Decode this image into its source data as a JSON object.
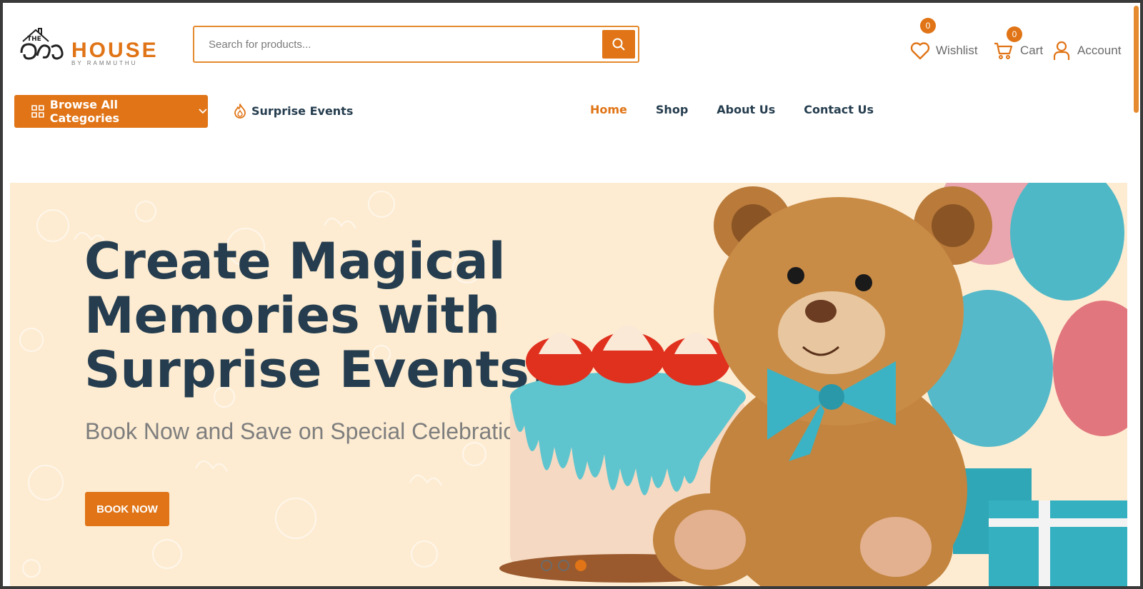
{
  "header": {
    "logo": {
      "the": "THE",
      "house": "HOUSE",
      "by": "BY RAMMUTHU"
    },
    "search_placeholder": "Search for products...",
    "wishlist": {
      "label": "Wishlist",
      "count": "0"
    },
    "cart": {
      "label": "Cart",
      "count": "0"
    },
    "account": {
      "label": "Account"
    }
  },
  "nav": {
    "browse": "Browse All Categories",
    "surprise": "Surprise Events",
    "links": [
      {
        "label": "Home",
        "active": true
      },
      {
        "label": "Shop"
      },
      {
        "label": "About Us"
      },
      {
        "label": "Contact Us"
      }
    ]
  },
  "hero": {
    "title_line1": "Create Magical",
    "title_line2": "Memories with",
    "title_line3": "Surprise Events!",
    "subtitle": "Book Now and Save on Special Celebrations!",
    "button": "BOOK NOW",
    "slides": 3,
    "active_slide": 3
  },
  "colors": {
    "accent": "#e07416",
    "navy": "#253d4e",
    "hero_bg": "#fdecd2"
  }
}
